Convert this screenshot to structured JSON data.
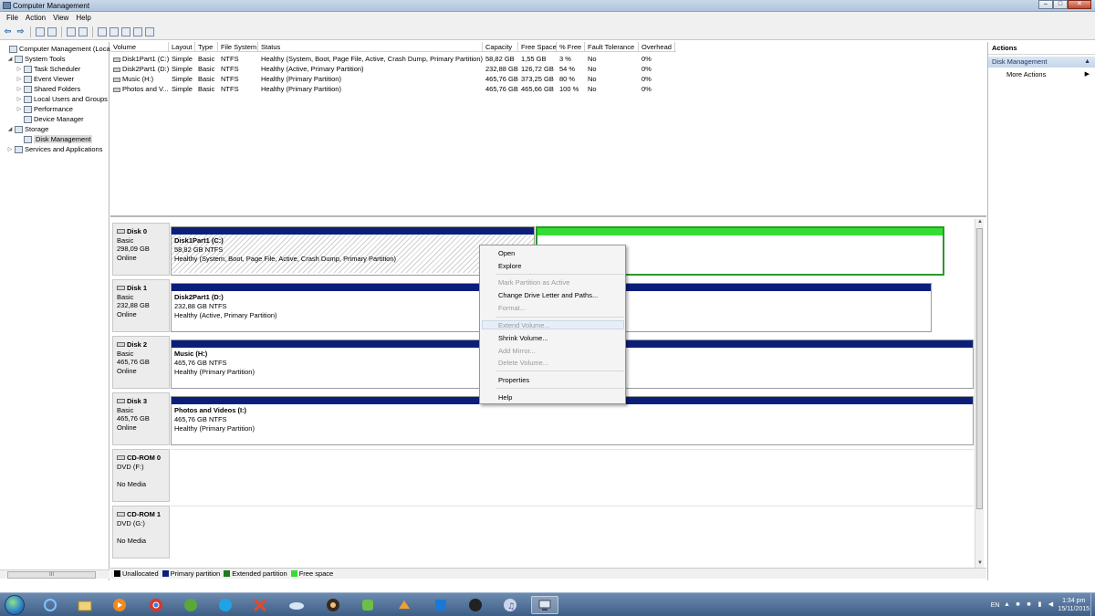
{
  "window": {
    "title": "Computer Management",
    "buttons": [
      "–",
      "□",
      "✕"
    ]
  },
  "menu": [
    "File",
    "Action",
    "View",
    "Help"
  ],
  "toolbar": {
    "icons": [
      "back-arrow-icon",
      "forward-arrow-icon",
      "up-folder-icon",
      "show-hide-tree-icon",
      "help-icon",
      "console-icon",
      "connect-icon",
      "disk-icon",
      "properties-icon",
      "refresh-icon",
      "export-icon"
    ],
    "glyphs": [
      "⇦",
      "⇨"
    ]
  },
  "tree": [
    {
      "label": "Computer Management (Local",
      "level": 0,
      "expander": "",
      "selected": false
    },
    {
      "label": "System Tools",
      "level": 1,
      "expander": "◢",
      "selected": false
    },
    {
      "label": "Task Scheduler",
      "level": 2,
      "expander": "▷",
      "selected": false
    },
    {
      "label": "Event Viewer",
      "level": 2,
      "expander": "▷",
      "selected": false
    },
    {
      "label": "Shared Folders",
      "level": 2,
      "expander": "▷",
      "selected": false
    },
    {
      "label": "Local Users and Groups",
      "level": 2,
      "expander": "▷",
      "selected": false
    },
    {
      "label": "Performance",
      "level": 2,
      "expander": "▷",
      "selected": false
    },
    {
      "label": "Device Manager",
      "level": 2,
      "expander": "",
      "selected": false
    },
    {
      "label": "Storage",
      "level": 1,
      "expander": "◢",
      "selected": false
    },
    {
      "label": "Disk Management",
      "level": 2,
      "expander": "",
      "selected": true
    },
    {
      "label": "Services and Applications",
      "level": 1,
      "expander": "▷",
      "selected": false
    }
  ],
  "tree_scroll_label": "III",
  "volume_columns": [
    "Volume",
    "Layout",
    "Type",
    "File System",
    "Status",
    "Capacity",
    "Free Space",
    "% Free",
    "Fault Tolerance",
    "Overhead"
  ],
  "volumes": [
    [
      "Disk1Part1 (C:)",
      "Simple",
      "Basic",
      "NTFS",
      "Healthy (System, Boot, Page File, Active, Crash Dump, Primary Partition)",
      "58,82 GB",
      "1,55 GB",
      "3 %",
      "No",
      "0%"
    ],
    [
      "Disk2Part1 (D:)",
      "Simple",
      "Basic",
      "NTFS",
      "Healthy (Active, Primary Partition)",
      "232,88 GB",
      "126,72 GB",
      "54 %",
      "No",
      "0%"
    ],
    [
      "Music (H:)",
      "Simple",
      "Basic",
      "NTFS",
      "Healthy (Primary Partition)",
      "465,76 GB",
      "373,25 GB",
      "80 %",
      "No",
      "0%"
    ],
    [
      "Photos and V...",
      "Simple",
      "Basic",
      "NTFS",
      "Healthy (Primary Partition)",
      "465,76 GB",
      "465,66 GB",
      "100 %",
      "No",
      "0%"
    ]
  ],
  "disks": [
    {
      "name": "Disk 0",
      "type": "Basic",
      "size": "298,09 GB",
      "status": "Online",
      "partition": {
        "name": "Disk1Part1  (C:)",
        "size": "58,82 GB NTFS",
        "status": "Healthy (System, Boot, Page File, Active, Crash Dump, Primary Partition)"
      }
    },
    {
      "name": "Disk 1",
      "type": "Basic",
      "size": "232,88 GB",
      "status": "Online",
      "partition": {
        "name": "Disk2Part1  (D:)",
        "size": "232,88 GB NTFS",
        "status": "Healthy (Active, Primary Partition)"
      }
    },
    {
      "name": "Disk 2",
      "type": "Basic",
      "size": "465,76 GB",
      "status": "Online",
      "partition": {
        "name": "Music  (H:)",
        "size": "465,76 GB NTFS",
        "status": "Healthy (Primary Partition)"
      }
    },
    {
      "name": "Disk 3",
      "type": "Basic",
      "size": "465,76 GB",
      "status": "Online",
      "partition": {
        "name": "Photos and Videos  (I:)",
        "size": "465,76 GB NTFS",
        "status": "Healthy (Primary Partition)"
      }
    }
  ],
  "cdroms": [
    {
      "name": "CD-ROM 0",
      "drive": "DVD (F:)",
      "media": "No Media"
    },
    {
      "name": "CD-ROM 1",
      "drive": "DVD (G:)",
      "media": "No Media"
    }
  ],
  "legend": [
    {
      "label": "Unallocated",
      "color": "#000000"
    },
    {
      "label": "Primary partition",
      "color": "#0b1f7a"
    },
    {
      "label": "Extended partition",
      "color": "#1e7a1e"
    },
    {
      "label": "Free space",
      "color": "#33dd33"
    }
  ],
  "actions": {
    "header": "Actions",
    "section": "Disk Management",
    "more": "More Actions"
  },
  "context_menu": [
    {
      "label": "Open",
      "enabled": true
    },
    {
      "label": "Explore",
      "enabled": true
    },
    {
      "label": "Mark Partition as Active",
      "enabled": false
    },
    {
      "label": "Change Drive Letter and Paths...",
      "enabled": true
    },
    {
      "label": "Format...",
      "enabled": false
    },
    {
      "label": "Extend Volume...",
      "enabled": false
    },
    {
      "label": "Shrink Volume...",
      "enabled": true
    },
    {
      "label": "Add Mirror...",
      "enabled": false
    },
    {
      "label": "Delete Volume...",
      "enabled": false
    },
    {
      "label": "Properties",
      "enabled": true
    },
    {
      "label": "Help",
      "enabled": true
    }
  ],
  "taskbar": {
    "apps": [
      "internet-explorer-icon",
      "file-explorer-icon",
      "media-player-icon",
      "chrome-icon",
      "utorrent-icon",
      "skype-icon",
      "xmind-icon",
      "icloud-icon",
      "app-icon",
      "evernote-icon",
      "paint-icon",
      "dropbox-icon",
      "steam-icon",
      "itunes-icon",
      "computer-management-icon"
    ],
    "language": "EN",
    "time": "1:34 pm",
    "date": "15/11/2015"
  }
}
